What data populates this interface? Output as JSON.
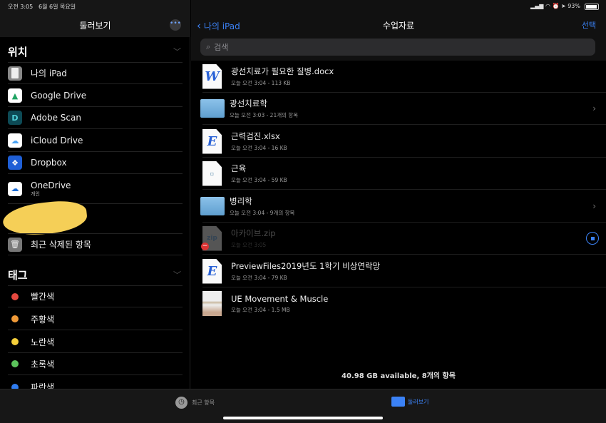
{
  "status": {
    "time": "오전 3:05",
    "date": "6월 6일 목요일",
    "battery": "93%"
  },
  "sidebar": {
    "title": "둘러보기",
    "locations_heading": "위치",
    "locations": [
      {
        "label": "나의 iPad",
        "icon": "ipad-icon"
      },
      {
        "label": "Google Drive",
        "icon": "google-drive-icon"
      },
      {
        "label": "Adobe Scan",
        "icon": "adobe-scan-icon"
      },
      {
        "label": "iCloud Drive",
        "icon": "icloud-icon"
      },
      {
        "label": "Dropbox",
        "icon": "dropbox-icon"
      },
      {
        "label": "OneDrive",
        "sub": "개인",
        "icon": "onedrive-icon"
      }
    ],
    "recently_deleted": "최근 삭제된 항목",
    "tags_heading": "태그",
    "tags": [
      {
        "label": "빨간색",
        "color": "#e5483f"
      },
      {
        "label": "주황색",
        "color": "#f09a38"
      },
      {
        "label": "노란색",
        "color": "#f5cf3a"
      },
      {
        "label": "초록색",
        "color": "#5bc35b"
      },
      {
        "label": "파란색",
        "color": "#2f7cf0"
      }
    ]
  },
  "main": {
    "back": "나의 iPad",
    "title": "수업자료",
    "select": "선택",
    "search_placeholder": "검색",
    "files": [
      {
        "name": "광선치료가 필요한 질병.docx",
        "meta": "오늘 오전 3:04 - 113 KB",
        "type": "word"
      },
      {
        "name": "광선치료학",
        "meta": "오늘 오전 3:03 - 21개의 항목",
        "type": "folder"
      },
      {
        "name": "근력검진.xlsx",
        "meta": "오늘 오전 3:04 - 16 KB",
        "type": "excel"
      },
      {
        "name": "근육",
        "meta": "오늘 오전 3:04 - 59 KB",
        "type": "doc"
      },
      {
        "name": "병리학",
        "meta": "오늘 오전 3:04 - 9개의 항목",
        "type": "folder"
      },
      {
        "name": "아카이브.zip",
        "meta": "오늘 오전 3:05",
        "type": "zip"
      },
      {
        "name": "PreviewFiles2019년도 1학기 비상연락망",
        "meta": "오늘 오전 3:04 - 79 KB",
        "type": "excel"
      },
      {
        "name": "UE Movement & Muscle",
        "meta": "오늘 오전 3:04 - 1.5 MB",
        "type": "image"
      }
    ],
    "footer": "40.98 GB available, 8개의 항목"
  },
  "tabbar": {
    "recents": "최근 항목",
    "browse": "둘러보기"
  },
  "accent": "#3b82f6"
}
